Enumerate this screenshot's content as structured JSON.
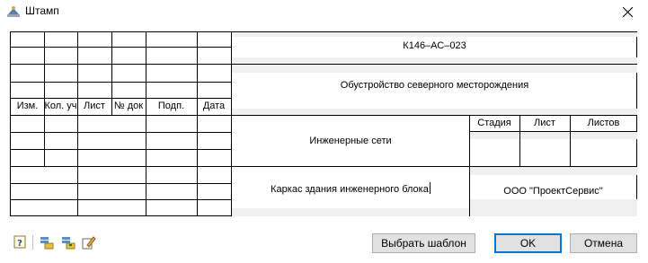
{
  "window": {
    "title": "Штамп",
    "icons": {
      "app": "stamp-app-icon",
      "close": "close-icon"
    }
  },
  "stamp": {
    "change_headers": [
      "Изм.",
      "Кол. уч",
      "Лист",
      "№ док",
      "Подп.",
      "Дата"
    ],
    "project_code": "К146–АС–023",
    "project_name": "Обустройство северного месторождения",
    "section_name": "Инженерные сети",
    "drawing_name": "Каркас здания инженерного блока",
    "stage_headers": [
      "Стадия",
      "Лист",
      "Листов"
    ],
    "organization": "ООО \"ПроектСервис\""
  },
  "toolbar": {
    "icons": [
      "help-icon",
      "load-template-icon",
      "save-template-icon",
      "edit-icon"
    ]
  },
  "buttons": {
    "choose_template": "Выбрать шаблон",
    "ok": "OK",
    "cancel": "Отмена"
  },
  "colors": {
    "cell_gray": "#f0f0f0",
    "grid_line": "#000000",
    "button_face": "#e1e1e1",
    "default_border": "#0078d7"
  }
}
